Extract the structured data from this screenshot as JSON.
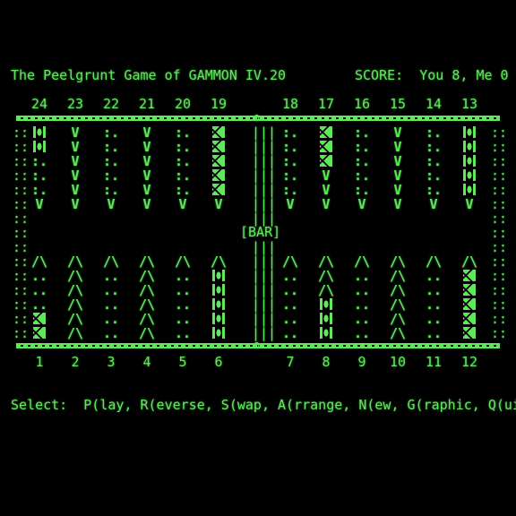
{
  "header": {
    "title": "The Peelgrunt Game of GAMMON IV.20",
    "score": "SCORE:  You 8, Me 0"
  },
  "board": {
    "top_numbers": [
      "24",
      "23",
      "22",
      "21",
      "20",
      "19",
      "18",
      "17",
      "16",
      "15",
      "14",
      "13"
    ],
    "bottom_numbers": [
      "1",
      "2",
      "3",
      "4",
      "5",
      "6",
      "7",
      "8",
      "9",
      "10",
      "11",
      "12"
    ],
    "bar_label": "[BAR]",
    "points_top": [
      {
        "point": "24",
        "you": 2,
        "me": 0
      },
      {
        "point": "23",
        "you": 0,
        "me": 0
      },
      {
        "point": "22",
        "you": 0,
        "me": 0
      },
      {
        "point": "21",
        "you": 0,
        "me": 0
      },
      {
        "point": "20",
        "you": 0,
        "me": 0
      },
      {
        "point": "19",
        "you": 0,
        "me": 5
      },
      {
        "point": "18",
        "you": 0,
        "me": 0
      },
      {
        "point": "17",
        "you": 0,
        "me": 3
      },
      {
        "point": "16",
        "you": 0,
        "me": 0
      },
      {
        "point": "15",
        "you": 0,
        "me": 0
      },
      {
        "point": "14",
        "you": 0,
        "me": 0
      },
      {
        "point": "13",
        "you": 5,
        "me": 0
      }
    ],
    "points_bottom": [
      {
        "point": "1",
        "you": 0,
        "me": 2
      },
      {
        "point": "2",
        "you": 0,
        "me": 0
      },
      {
        "point": "3",
        "you": 0,
        "me": 0
      },
      {
        "point": "4",
        "you": 0,
        "me": 0
      },
      {
        "point": "5",
        "you": 0,
        "me": 0
      },
      {
        "point": "6",
        "you": 5,
        "me": 0
      },
      {
        "point": "7",
        "you": 0,
        "me": 0
      },
      {
        "point": "8",
        "you": 3,
        "me": 0
      },
      {
        "point": "9",
        "you": 0,
        "me": 0
      },
      {
        "point": "10",
        "you": 0,
        "me": 0
      },
      {
        "point": "11",
        "you": 0,
        "me": 0
      },
      {
        "point": "12",
        "you": 0,
        "me": 5
      }
    ]
  },
  "prompt": "Select:  P(lay, R(everse, S(wap, A(rrange, N(ew, G(raphic, Q(uit",
  "colors": {
    "phosphor_green": "#5ee85a",
    "background": "#000000"
  }
}
